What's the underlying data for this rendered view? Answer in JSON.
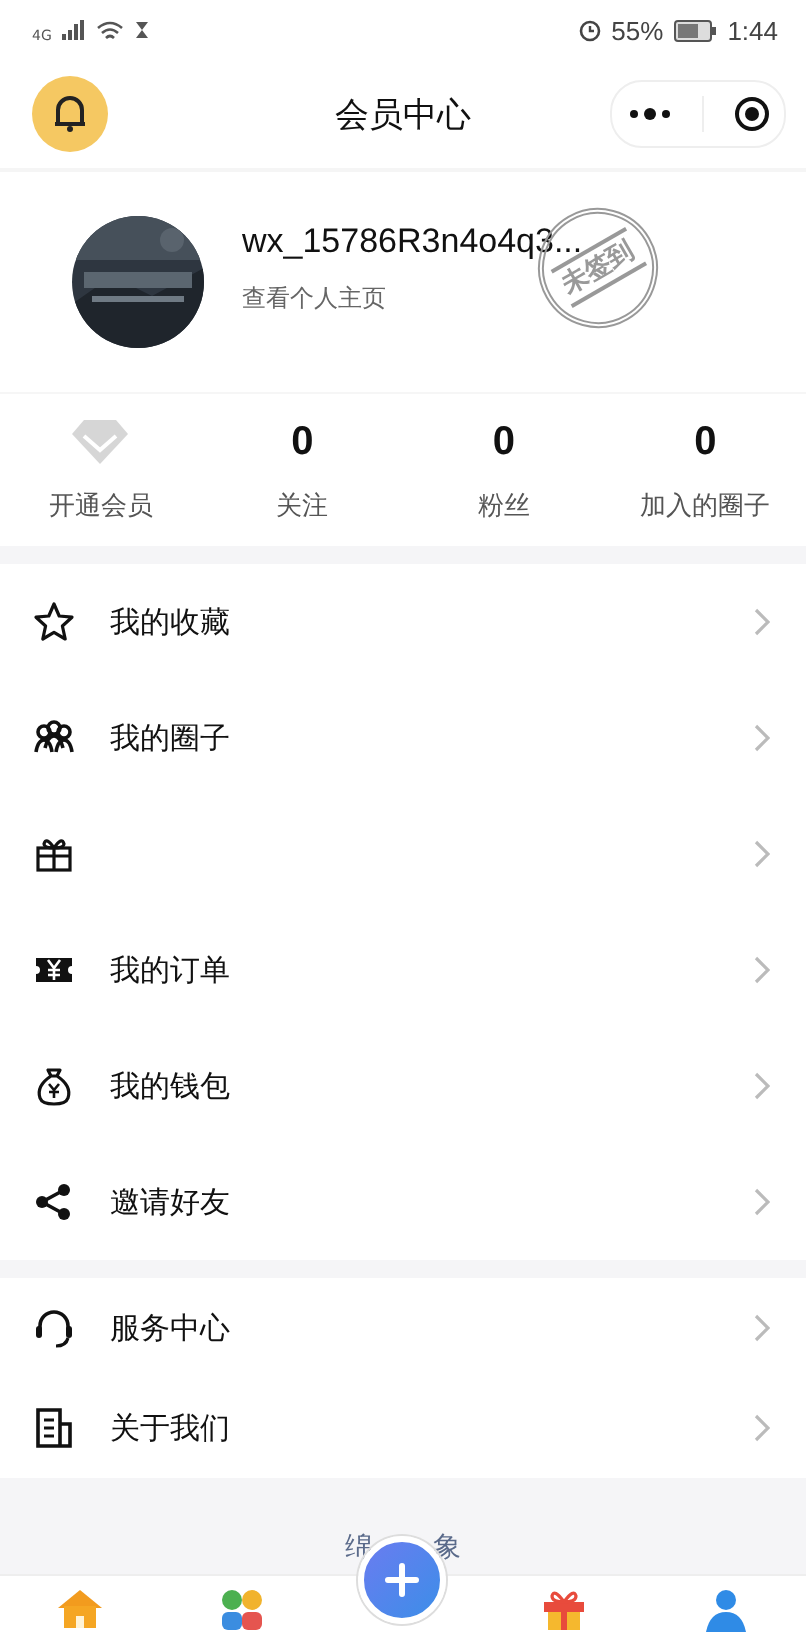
{
  "status_bar": {
    "network": "4G",
    "battery": "55%",
    "time": "1:44"
  },
  "header": {
    "title": "会员中心"
  },
  "profile": {
    "name": "wx_15786R3n4o4q3...",
    "link": "查看个人主页",
    "stamp": "未签到"
  },
  "stats": [
    {
      "kind": "vip",
      "label": "开通会员"
    },
    {
      "kind": "count",
      "value": "0",
      "label": "关注"
    },
    {
      "kind": "count",
      "value": "0",
      "label": "粉丝"
    },
    {
      "kind": "count",
      "value": "0",
      "label": "加入的圈子"
    }
  ],
  "menu_groups": [
    [
      {
        "kind": "star",
        "label": "我的收藏"
      },
      {
        "kind": "people",
        "label": "我的圈子"
      },
      {
        "kind": "gift"
      },
      {
        "kind": "ticket",
        "label": "我的订单"
      },
      {
        "kind": "moneybag",
        "label": "我的钱包"
      },
      {
        "kind": "share",
        "label": "邀请好友"
      }
    ],
    [
      {
        "kind": "headset",
        "label": "服务中心"
      },
      {
        "kind": "document",
        "label": "关于我们"
      }
    ]
  ],
  "footer": {
    "text_parts": [
      "绵",
      "象"
    ]
  },
  "tab_bar": [
    {
      "kind": "home"
    },
    {
      "kind": "apps"
    },
    {
      "kind": "plus"
    },
    {
      "kind": "gift"
    },
    {
      "kind": "person"
    }
  ]
}
